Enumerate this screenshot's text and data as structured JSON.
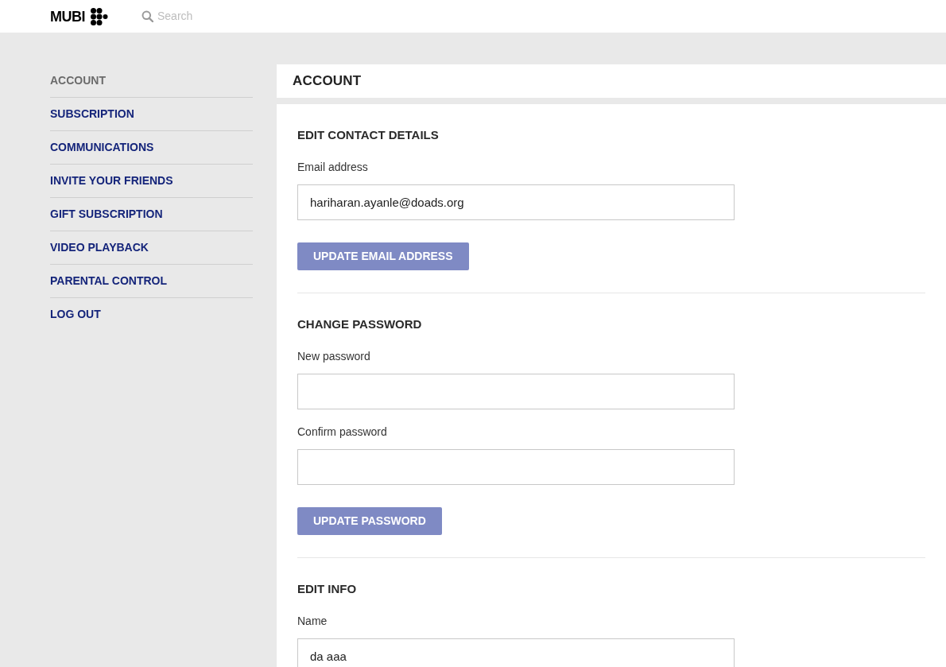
{
  "header": {
    "logo": "MUBI",
    "search": {
      "placeholder": "Search"
    }
  },
  "sidebar": {
    "items": [
      {
        "label": "ACCOUNT",
        "selected": true
      },
      {
        "label": "SUBSCRIPTION",
        "selected": false
      },
      {
        "label": "COMMUNICATIONS",
        "selected": false
      },
      {
        "label": "INVITE YOUR FRIENDS",
        "selected": false
      },
      {
        "label": "GIFT SUBSCRIPTION",
        "selected": false
      },
      {
        "label": "VIDEO PLAYBACK",
        "selected": false
      },
      {
        "label": "PARENTAL CONTROL",
        "selected": false
      },
      {
        "label": "LOG OUT",
        "selected": false
      }
    ]
  },
  "page": {
    "title": "ACCOUNT",
    "sections": [
      {
        "title": "EDIT CONTACT DETAILS",
        "fields": [
          {
            "label": "Email address",
            "value": "hariharan.ayanle@doads.org"
          }
        ],
        "button": "UPDATE EMAIL ADDRESS"
      },
      {
        "title": "CHANGE PASSWORD",
        "fields": [
          {
            "label": "New password"
          },
          {
            "label": "Confirm password"
          }
        ],
        "button": "UPDATE PASSWORD"
      },
      {
        "title": "EDIT INFO",
        "fields": [
          {
            "label": "Name",
            "value": "da aaa"
          }
        ]
      }
    ]
  }
}
